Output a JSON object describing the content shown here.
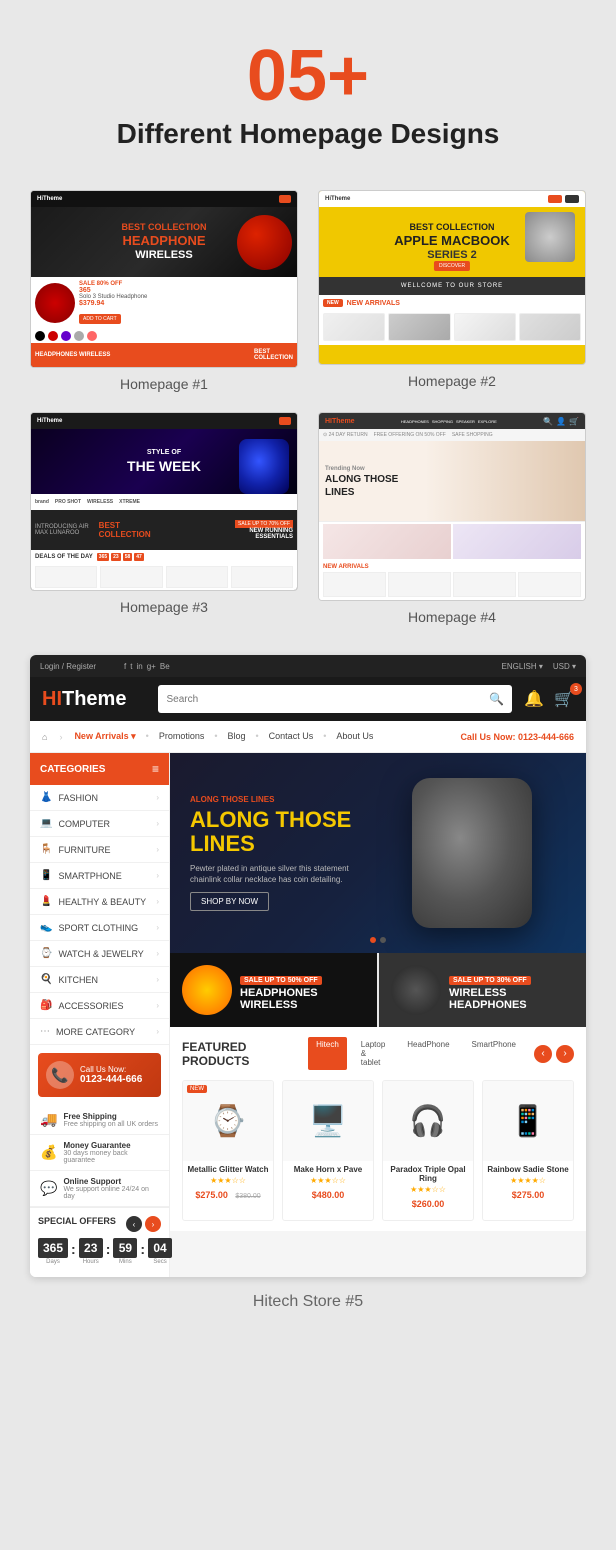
{
  "header": {
    "number": "05+",
    "title": "Different Homepage Designs"
  },
  "previews": [
    {
      "label": "Homepage #1"
    },
    {
      "label": "Homepage #2"
    },
    {
      "label": "Homepage #3"
    },
    {
      "label": "Homepage #4"
    }
  ],
  "hp1": {
    "hero_text": "HEADPHONE\nWIRELESS",
    "footer_text": "HEADPHONES WIRELESS",
    "footer_right": "BEST COLLECTION"
  },
  "hp2": {
    "hero_text": "APPLE MACBOOK\nSERIES 2",
    "store_text": "WELLCOME TO OUR STORE",
    "arrivals_label": "NEW ARRIVALS"
  },
  "hp3": {
    "hero_sub": "Style of",
    "hero_main": "THE WEEK",
    "coll_text": "BEST\nCOLLECTION",
    "deals": "DEALS OF THE DAY",
    "timer": [
      "365",
      "23",
      "58",
      "47"
    ]
  },
  "hp4": {
    "tagline": "Trending Now",
    "hero_big": "ALONG THOSE LINES",
    "arrivals_label": "NEW ARRIVALS"
  },
  "hp5": {
    "topbar": {
      "login": "Login / Register",
      "social": [
        "f",
        "t",
        "in",
        "g+",
        "Be"
      ],
      "lang": "ENGLISH ▾",
      "currency": "USD ▾"
    },
    "nav": {
      "logo_hi": "HI",
      "logo_theme": "Theme",
      "search_placeholder": "Search",
      "cart_count": "3"
    },
    "catnav": {
      "home_icon": "⌂",
      "items": [
        "New Arrivals ▾",
        "Promotions",
        "Blog",
        "Contact Us",
        "About Us"
      ],
      "phone": "Call Us Now: 0123-444-666"
    },
    "sidebar": {
      "title": "CATEGORIES",
      "items": [
        {
          "icon": "👗",
          "label": "FASHION"
        },
        {
          "icon": "💻",
          "label": "COMPUTER"
        },
        {
          "icon": "🪑",
          "label": "FURNITURE"
        },
        {
          "icon": "📱",
          "label": "SMARTPHONE"
        },
        {
          "icon": "💄",
          "label": "HEALTHY & BEAUTY"
        },
        {
          "icon": "👟",
          "label": "SPORT CLOTHING"
        },
        {
          "icon": "⌚",
          "label": "WATCH & JEWELRY"
        },
        {
          "icon": "🍳",
          "label": "KITCHEN"
        },
        {
          "icon": "🎒",
          "label": "ACCESSORIES"
        },
        {
          "icon": "⋯",
          "label": "MORE CATEGORY"
        }
      ],
      "info_label": "Call Us Now:",
      "info_phone": "0123-444-666",
      "benefits": [
        {
          "title": "Free Shipping",
          "desc": "Free shipping on all UK orders"
        },
        {
          "title": "Money Guarantee",
          "desc": "30 days money back guarantee"
        },
        {
          "title": "Online Support",
          "desc": "We support online 24/24 on day"
        }
      ],
      "special_title": "SPECIAL OFFERS",
      "timer": {
        "days": "365",
        "hours": "23",
        "mins": "59",
        "secs": "04",
        "labels": [
          "Days",
          "Hours",
          "Mins",
          "Secs"
        ]
      }
    },
    "hero": {
      "tagline": "Along Those Lines",
      "title": "ALONG THOSE\nLINES",
      "desc": "Pewter plated in antique silver this statement chainlink\ncollar necklace has coin detailing.",
      "btn": "SHOP BY NOW"
    },
    "promo": [
      {
        "sale": "SALE UP TO 50% OFF",
        "title": "HEADPHONES\nWIRELESS"
      },
      {
        "sale": "SALE UP TO 30% OFF",
        "title": "WIRELESS\nHEADPHONES"
      }
    ],
    "featured": {
      "title": "FEATURED PRODUCTS",
      "tabs": [
        "Hitech",
        "Laptop & tablet",
        "HeadPhone",
        "SmartPhone"
      ],
      "active_tab": 0,
      "products": [
        {
          "badge": "NEW",
          "name": "Metallic Glitter Watch",
          "stars": 3,
          "price": "$275.00",
          "old_price": "$380.00",
          "icon": "⌚"
        },
        {
          "badge": "",
          "name": "Make Horn x Pave",
          "stars": 3,
          "price": "$480.00",
          "old_price": "",
          "icon": "🖥️"
        },
        {
          "badge": "",
          "name": "Paradox Triple Opal Ring",
          "stars": 3,
          "price": "$260.00",
          "old_price": "",
          "icon": "🎧"
        },
        {
          "badge": "",
          "name": "Rainbow Sadie Stone",
          "stars": 4,
          "price": "$275.00",
          "old_price": "",
          "icon": "📱"
        }
      ]
    },
    "bottom_label": "Hitech Store #5"
  }
}
